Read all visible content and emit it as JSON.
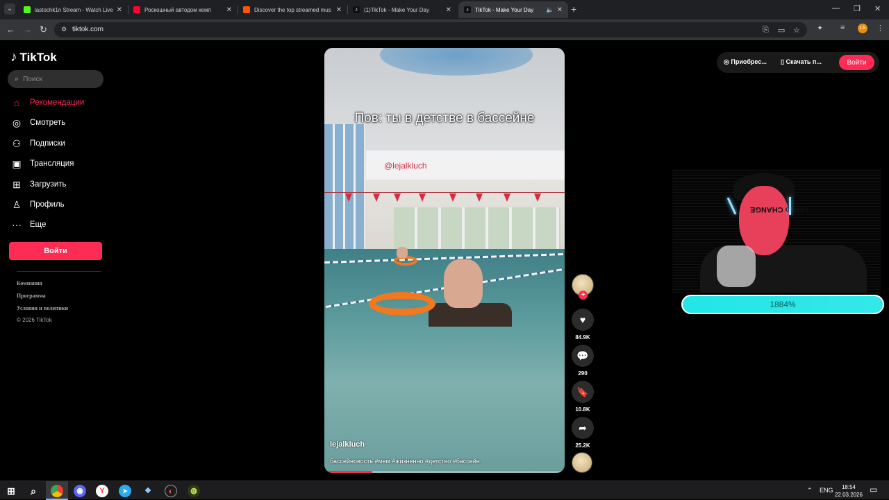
{
  "browser": {
    "tabs": [
      {
        "title": "lastochk1n Stream - Watch Live",
        "favicon_color": "#53fc18",
        "active": false
      },
      {
        "title": "Роскошный автодом кемп",
        "favicon_color": "#ff0033",
        "active": false
      },
      {
        "title": "Discover the top streamed mus",
        "favicon_color": "#ff5500",
        "active": false
      },
      {
        "title": "(1)TikTok - Make Your Day",
        "favicon_color": "#ffffff",
        "active": false
      },
      {
        "title": "TikTok - Make Your Day",
        "favicon_color": "#ffffff",
        "active": true
      }
    ],
    "url": "tiktok.com",
    "profile_initial": "LS"
  },
  "tiktok": {
    "logo_text": "TikTok",
    "search_placeholder": "Поиск",
    "nav": [
      {
        "label": "Рекомендации",
        "icon": "home-icon",
        "active": true
      },
      {
        "label": "Смотреть",
        "icon": "compass-icon",
        "active": false
      },
      {
        "label": "Подписки",
        "icon": "user-plus-icon",
        "active": false
      },
      {
        "label": "Трансляция",
        "icon": "live-tv-icon",
        "active": false
      },
      {
        "label": "Загрузить",
        "icon": "upload-icon",
        "active": false
      },
      {
        "label": "Профиль",
        "icon": "profile-icon",
        "active": false
      },
      {
        "label": "Еще",
        "icon": "more-icon",
        "active": false
      }
    ],
    "login_label": "Войти",
    "footer": {
      "links": [
        "Компания",
        "Программа",
        "Условия и политики"
      ],
      "copyright": "© 2026 TikTok"
    },
    "top_bar": {
      "buy_label": "Приобрес...",
      "download_label": "Скачать п...",
      "login_label": "Войти"
    },
    "video": {
      "caption": "Пов: ты в детстве в бассейне",
      "watermark": "@lejalkluch",
      "author": "lejalkluch",
      "hashtags": "бассейновость #мем #жизненно #детство #бассейн",
      "progress": 0.2
    },
    "actions": {
      "likes": "84.9K",
      "comments": "290",
      "saves": "10.8K",
      "shares": "25.2K"
    }
  },
  "overlay": {
    "face_text": "TAP to CHANGE",
    "tap_percent": "1884%",
    "accent": "#22e5e5"
  },
  "taskbar": {
    "language": "ENG",
    "time": "18:54",
    "date": "22.03.2026"
  },
  "colors": {
    "brand": "#fe2c55",
    "background": "#000000"
  }
}
